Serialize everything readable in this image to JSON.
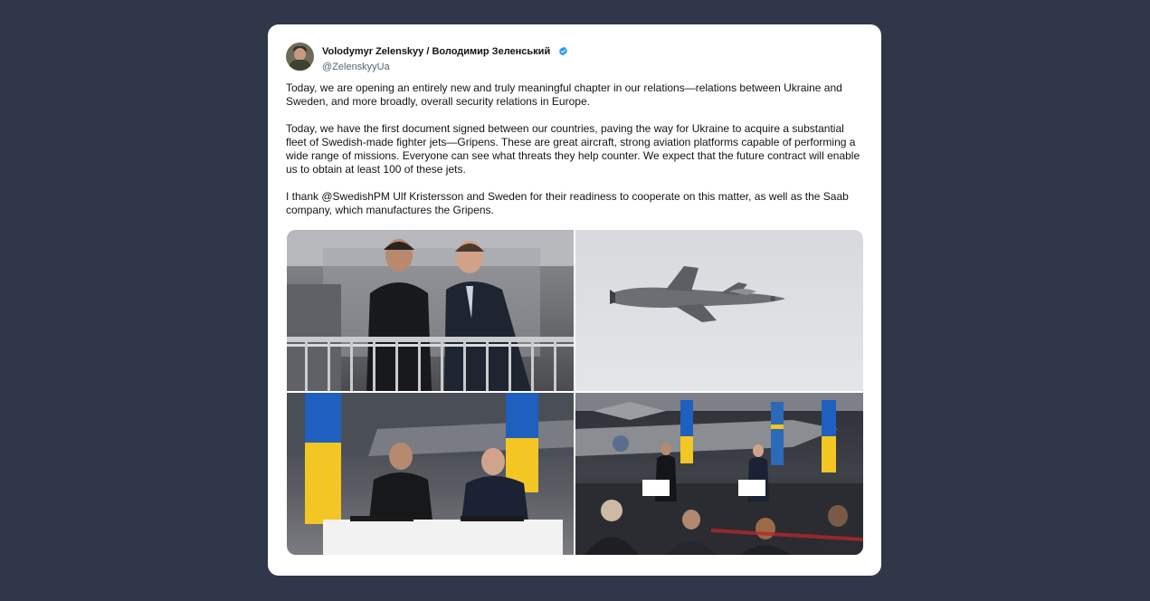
{
  "tweet": {
    "display_name": "Volodymyr Zelenskyy / Володимир Зеленський",
    "handle": "@ZelenskyyUa",
    "paragraphs": [
      "Today, we are opening an entirely new and truly meaningful chapter in our relations—relations between Ukraine and Sweden, and more broadly, overall security relations in Europe.",
      "Today, we have the first document signed between our countries, paving the way for Ukraine to acquire a substantial fleet of Swedish-made fighter jets—Gripens. These are great aircraft, strong aviation platforms capable of performing a wide range of missions. Everyone can see what threats they help counter. We expect that the future contract will enable us to obtain at least 100 of these jets.",
      "I thank @SwedishPM Ulf Kristersson and Sweden for their readiness to cooperate on this matter, as well as the Saab company, which manufactures the Gripens."
    ],
    "verified_icon": "verified-badge-icon",
    "colors": {
      "background": "#2f3748",
      "card": "#ffffff",
      "verified": "#1d9bf0",
      "text": "#0f1419",
      "handle": "#536471"
    }
  },
  "photos": [
    {
      "subject": "two-leaders-at-railing"
    },
    {
      "subject": "gripen-jet-in-flight"
    },
    {
      "subject": "signing-ceremony"
    },
    {
      "subject": "press-conference-hangar"
    }
  ]
}
